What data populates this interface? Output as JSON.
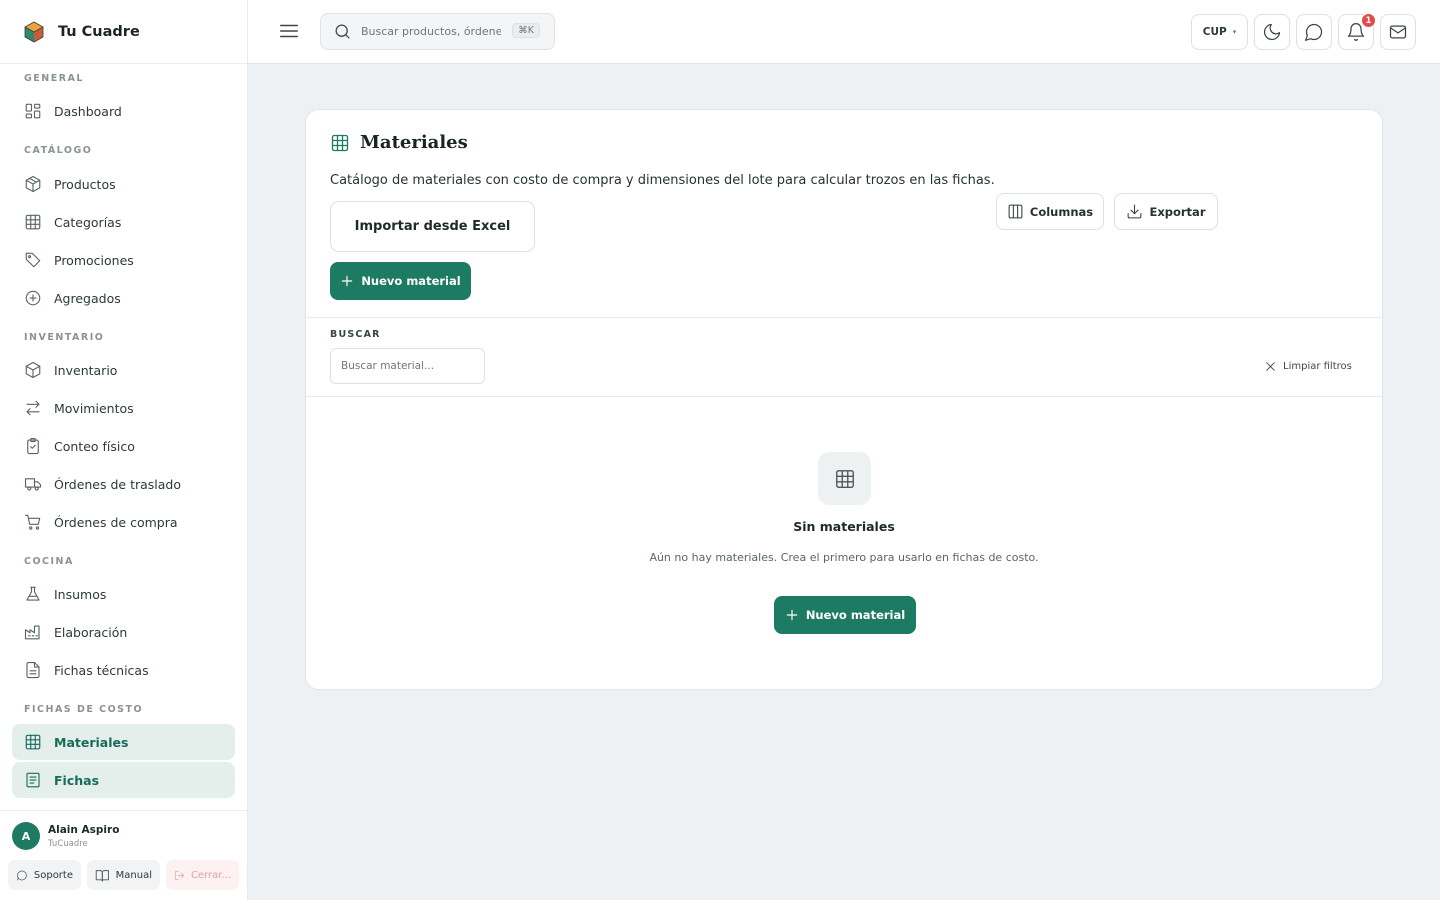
{
  "brand": {
    "name": "Tu Cuadre"
  },
  "sidebar": {
    "sections": {
      "general": "GENERAL",
      "catalogo": "CATÁLOGO",
      "inventario": "INVENTARIO",
      "cocina": "COCINA",
      "fichas": "FICHAS DE COSTO"
    },
    "items": {
      "dashboard": "Dashboard",
      "productos": "Productos",
      "categorias": "Categorías",
      "promociones": "Promociones",
      "agregados": "Agregados",
      "inventario": "Inventario",
      "movimientos": "Movimientos",
      "conteo": "Conteo físico",
      "traslado": "Órdenes de traslado",
      "compra": "Órdenes de compra",
      "insumos": "Insumos",
      "elaboracion": "Elaboración",
      "fichas_tecnicas": "Fichas técnicas",
      "materiales": "Materiales",
      "fichas": "Fichas"
    },
    "active_item": "Materiales"
  },
  "user": {
    "initial": "A",
    "name": "Alain Aspiro",
    "org": "TuCuadre",
    "support": "Soporte",
    "manual": "Manual",
    "logout": "Cerrar..."
  },
  "topbar": {
    "search_placeholder": "Buscar productos, órdenes...",
    "shortcut": "⌘K",
    "currency": "CUP",
    "notification_count": "1"
  },
  "page": {
    "title": "Materiales",
    "description": "Catálogo de materiales con costo de compra y dimensiones del lote para calcular trozos en las fichas.",
    "columns_button": "Columnas",
    "export_button": "Exportar",
    "import_button": "Importar desde Excel",
    "new_button": "Nuevo material",
    "search_label": "BUSCAR",
    "search_placeholder": "Buscar material...",
    "clear_filters": "Limpiar filtros",
    "empty_title": "Sin materiales",
    "empty_description": "Aún no hay materiales. Crea el primero para usarlo en fichas de costo.",
    "empty_button": "Nuevo material"
  },
  "colors": {
    "accent": "#1d7a63",
    "active_bg": "#e4efec",
    "badge": "#e24b4b"
  },
  "icons": {
    "brand": "cube-logo-icon",
    "search": "search-icon",
    "menu": "hamburger-icon",
    "theme": "moon-icon",
    "chat": "chat-bubble-icon",
    "notifications": "bell-icon",
    "mail": "mail-icon",
    "page": "grid-table-icon"
  }
}
